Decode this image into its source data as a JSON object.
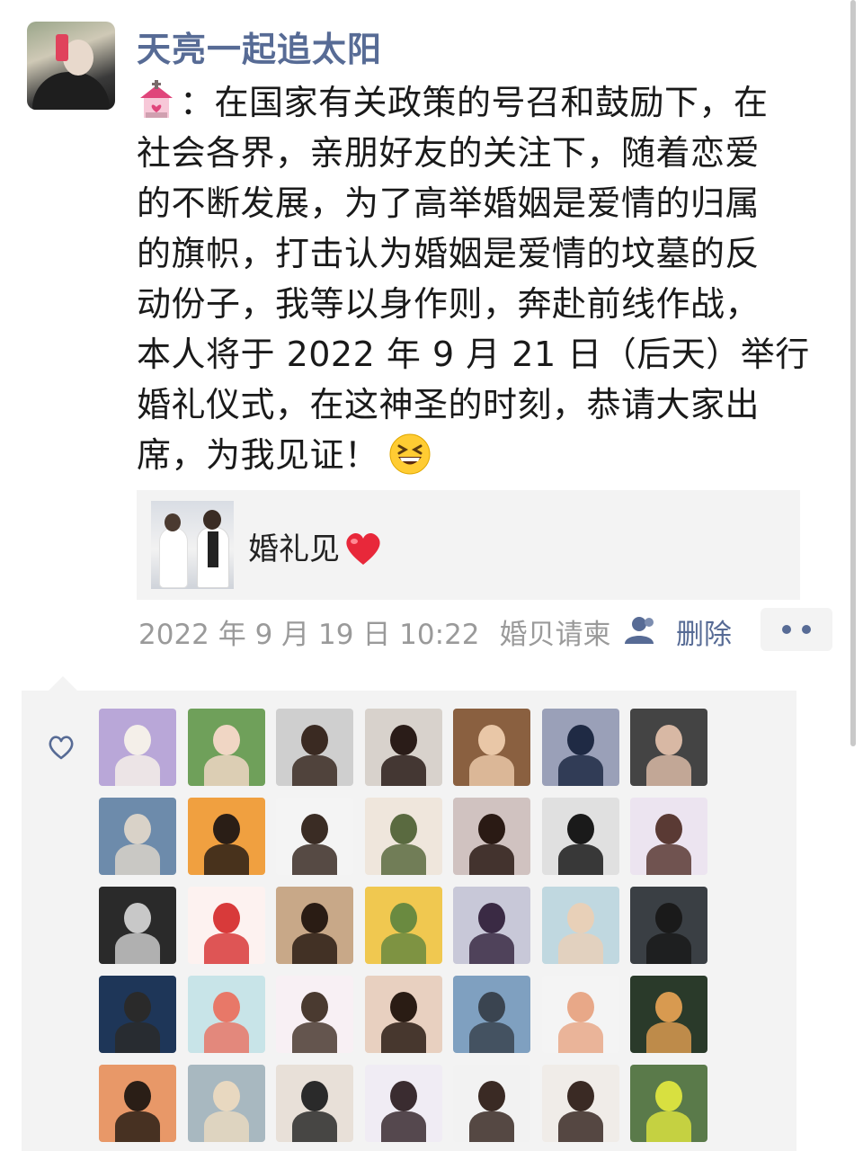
{
  "post": {
    "username": "天亮一起追太阳",
    "lines": [
      "：在国家有关政策的号召和鼓励下，在",
      "社会各界，亲朋好友的关注下，随着恋爱",
      "的不断发展，为了高举婚姻是爱情的归属",
      "的旗帜，打击认为婚姻是爱情的坟墓的反",
      "动份子，我等以身作则，奔赴前线作战，",
      "本人将于 2022 年 9 月 21 日（后天）举行",
      "婚礼仪式，在这神圣的时刻，恭请大家出",
      "席，为我见证！"
    ],
    "link_title": "婚礼见",
    "timestamp": "2022 年 9 月 19 日 10:22",
    "source": "婚贝请柬",
    "delete_label": "删除"
  },
  "icons": {
    "leading_emoji": "wedding-chapel-emoji",
    "trailing_emoji": "grinning-squinting-face-emoji",
    "link_emoji": "red-heart-emoji",
    "visibility": "person-icon",
    "more": "more-dots-icon",
    "like": "heart-outline-icon"
  },
  "colors": {
    "name_link": "#576b95",
    "meta_gray": "#9a9a9a",
    "panel_bg": "#f3f3f3"
  },
  "likes": {
    "count_rows": 5,
    "count_cols": 7,
    "avatars": [
      [
        "#b9a7d8",
        "#f4efe9"
      ],
      [
        "#6fa05a",
        "#f0d6c4"
      ],
      [
        "#cfcfcf",
        "#3a2a22"
      ],
      [
        "#d8d2cc",
        "#2a1c18"
      ],
      [
        "#8a6040",
        "#e9c7a7"
      ],
      [
        "#9aa0b8",
        "#1f2a44"
      ],
      [
        "#444444",
        "#d8b8a4"
      ],
      [
        "#6d8bab",
        "#d9d2c8"
      ],
      [
        "#f0a040",
        "#2a1e16"
      ],
      [
        "#f4f4f4",
        "#3a2c24"
      ],
      [
        "#efe6dc",
        "#5a6a40"
      ],
      [
        "#d0c2c0",
        "#2a1a14"
      ],
      [
        "#e0e0e0",
        "#1a1a1a"
      ],
      [
        "#ece4f0",
        "#5a3a34"
      ],
      [
        "#2a2a2a",
        "#c8c8c8"
      ],
      [
        "#fdf2f0",
        "#d83a3a"
      ],
      [
        "#c8a888",
        "#2a1c14"
      ],
      [
        "#f0c850",
        "#6a8a40"
      ],
      [
        "#c8c8d8",
        "#3a2a44"
      ],
      [
        "#c0d8e0",
        "#e8d0b8"
      ],
      [
        "#3a3f44",
        "#1a1a1a"
      ],
      [
        "#1e3658",
        "#2a2a2a"
      ],
      [
        "#c8e4e8",
        "#e87868"
      ],
      [
        "#f8f0f4",
        "#4a3a30"
      ],
      [
        "#e8d0c0",
        "#2a1c14"
      ],
      [
        "#7fa0c0",
        "#3a4450"
      ],
      [
        "#f4f4f4",
        "#e8a888"
      ],
      [
        "#2a3a2a",
        "#d89a50"
      ],
      [
        "#e89868",
        "#2a1e16"
      ],
      [
        "#a8b8c0",
        "#e8d8c0"
      ],
      [
        "#e8e0d8",
        "#2a2a2a"
      ],
      [
        "#f0ecf4",
        "#3a2c30"
      ],
      [
        "#f2f2f2",
        "#3a2a24"
      ],
      [
        "#f0ece8",
        "#3a2a24"
      ],
      [
        "#5a7a4a",
        "#d8e040"
      ]
    ]
  }
}
